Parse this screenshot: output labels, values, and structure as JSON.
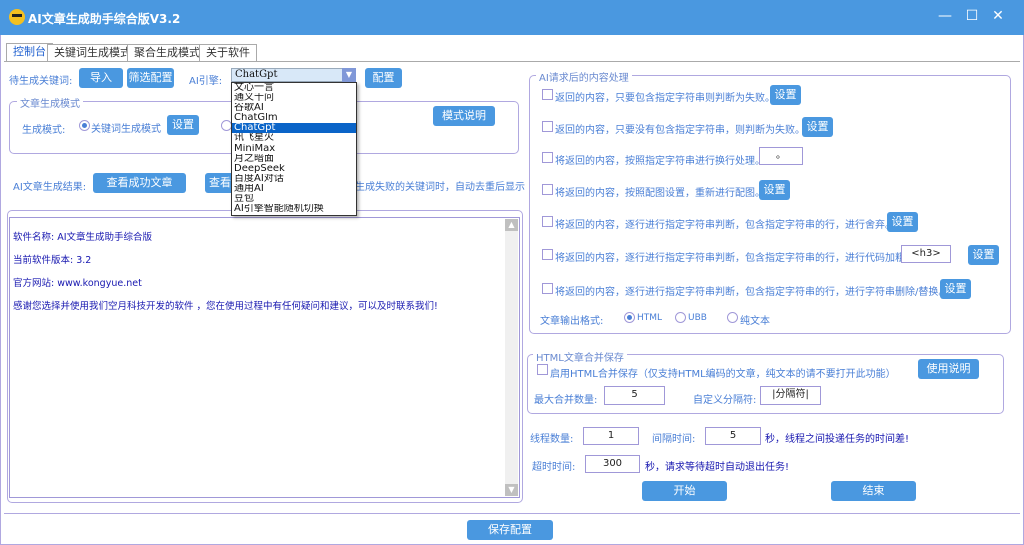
{
  "window": {
    "title": "AI文章生成助手综合版V3.2",
    "minimize": "—",
    "maximize": "☐",
    "close": "✕"
  },
  "tabs": [
    "控制台",
    "关键词生成模式",
    "聚合生成模式",
    "关于软件"
  ],
  "top": {
    "keywords_label": "待生成关键词:",
    "import": "导入",
    "filter": "筛选配置",
    "engine_label": "AI引擎:",
    "engine_value": "ChatGpt",
    "config": "配置"
  },
  "engine_options": [
    "文心一言",
    "通义千问",
    "谷歌AI",
    "ChatGlm",
    "ChatGpt",
    "讯飞星火",
    "MiniMax",
    "月之暗面",
    "DeepSeek",
    "百度AI对话",
    "通用AI",
    "豆包",
    "AI引擎智能随机切换"
  ],
  "mode": {
    "legend": "文章生成模式",
    "label": "生成模式:",
    "option1": "关键词生成模式",
    "option1_selected": true,
    "settings": "设置",
    "explain": "模式说明"
  },
  "results": {
    "label": "AI文章生成结果:",
    "view_success": "查看成功文章",
    "view_other": "查看",
    "note": "生成失败的关键词时，自动去重后显示"
  },
  "log": [
    "软件名称: AI文章生成助手综合版",
    "当前软件版本: 3.2",
    "官方网站: www.kongyue.net",
    "感谢您选择并使用我们空月科技开发的软件 ，您在使用过程中有任何疑问和建议，可以及时联系我们!"
  ],
  "processing": {
    "legend": "AI请求后的内容处理",
    "rows": [
      {
        "text": "返回的内容，只要包含指定字符串则判断为失败。",
        "button": "设置"
      },
      {
        "text": "返回的内容，只要没有包含指定字符串，则判断为失败。",
        "button": "设置"
      },
      {
        "text": "将返回的内容，按照指定字符串进行换行处理。",
        "input": "。"
      },
      {
        "text": "将返回的内容，按照配图设置，重新进行配图。",
        "button": "设置"
      },
      {
        "text": "将返回的内容，逐行进行指定字符串判断，包含指定字符串的行，进行舍弃。",
        "button": "设置"
      },
      {
        "text": "将返回的内容，逐行进行指定字符串判断，包含指定字符串的行，进行代码加粗。",
        "input": "<h3>",
        "button": "设置"
      },
      {
        "text": "将返回的内容，逐行进行指定字符串判断，包含指定字符串的行，进行字符串删除/替换。",
        "button": "设置"
      }
    ],
    "format_label": "文章输出格式:",
    "formats": [
      "HTML",
      "UBB",
      "纯文本"
    ],
    "format_selected": "HTML"
  },
  "merge": {
    "legend": "HTML文章合并保存",
    "enable": "启用HTML合并保存（仅支持HTML编码的文章，纯文本的请不要打开此功能）",
    "help": "使用说明",
    "max_label": "最大合并数量:",
    "max_value": "5",
    "sep_label": "自定义分隔符:",
    "sep_value": "|分隔符|"
  },
  "threads": {
    "label": "线程数量:",
    "value": "1",
    "interval_label": "间隔时间:",
    "interval_value": "5",
    "interval_note": "秒，线程之间投递任务的时间差!",
    "timeout_label": "超时时间:",
    "timeout_value": "300",
    "timeout_note": "秒，请求等待超时自动退出任务!"
  },
  "actions": {
    "start": "开始",
    "stop": "结束",
    "save": "保存配置"
  }
}
